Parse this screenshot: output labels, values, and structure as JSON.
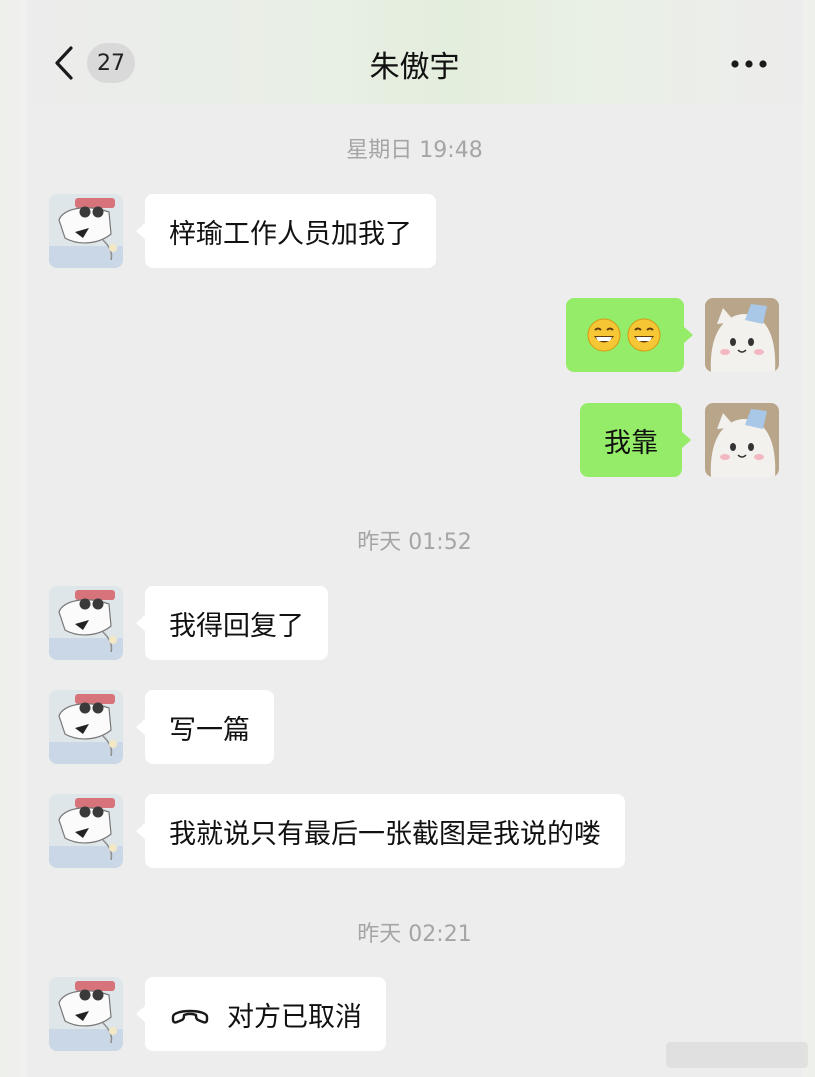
{
  "header": {
    "unread_count": "27",
    "title": "朱傲宇"
  },
  "messages": [
    {
      "type": "time",
      "text": "星期日 19:48"
    },
    {
      "type": "in",
      "text": "梓瑜工作人员加我了"
    },
    {
      "type": "out",
      "content": "emoji",
      "emoji": [
        "grinning-face-icon",
        "grinning-face-icon"
      ]
    },
    {
      "type": "out",
      "text": "我靠"
    },
    {
      "type": "time",
      "text": "昨天 01:52"
    },
    {
      "type": "in",
      "text": "我得回复了"
    },
    {
      "type": "in",
      "text": "写一篇"
    },
    {
      "type": "in",
      "text": "我就说只有最后一张截图是我说的喽"
    },
    {
      "type": "time",
      "text": "昨天 02:21"
    },
    {
      "type": "in",
      "text": "对方已取消",
      "icon": "hang-up-icon"
    }
  ],
  "colors": {
    "outgoing_bubble": "#95ec69",
    "incoming_bubble": "#ffffff",
    "background": "#ededed",
    "timestamp": "#a5a5a5"
  }
}
